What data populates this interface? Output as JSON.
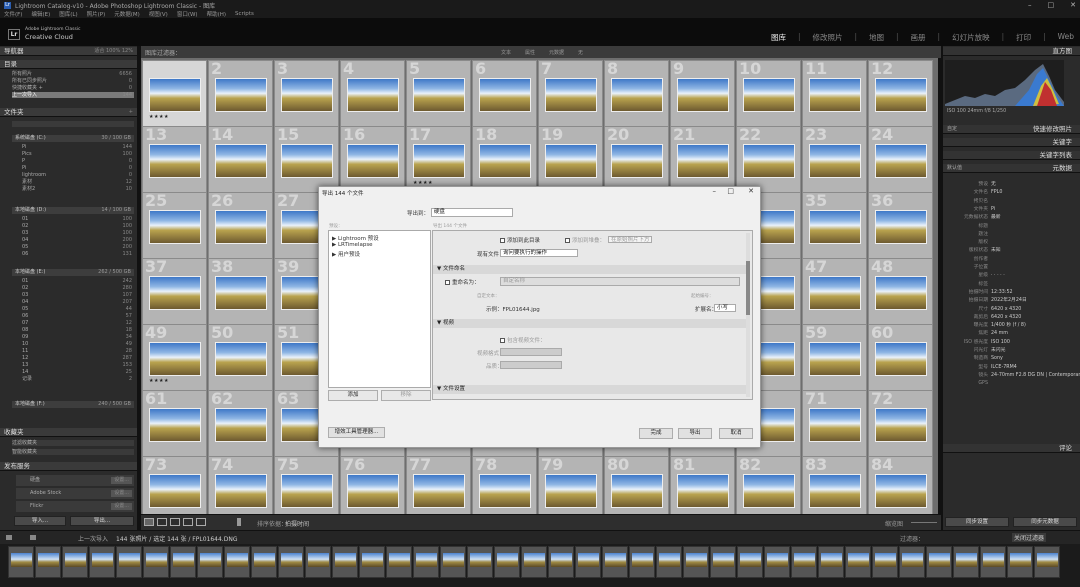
{
  "window": {
    "title": "Lightroom Catalog-v10 - Adobe Photoshop Lightroom Classic - 图库",
    "app_icon": "Lr"
  },
  "menu": [
    "文件(F)",
    "编辑(E)",
    "图库(L)",
    "照片(P)",
    "元数据(M)",
    "视图(V)",
    "窗口(W)",
    "帮助(H)",
    "Scripts"
  ],
  "brand": {
    "logo": "Lr",
    "line1": "Adobe Lightroom Classic",
    "line2": "Creative Cloud"
  },
  "modules": [
    "图库",
    "修改照片",
    "地图",
    "画册",
    "幻灯片放映",
    "打印",
    "Web"
  ],
  "left": {
    "navigator": {
      "title": "导航器",
      "opts": "适合  100%  12%"
    },
    "catalog": {
      "title": "目录",
      "items": [
        {
          "label": "所有照片",
          "count": "6656"
        },
        {
          "label": "所有已同步照片",
          "count": "0"
        },
        {
          "label": "快捷收藏夹 +",
          "count": "0"
        },
        {
          "label": "上一次导入",
          "count": "144"
        }
      ]
    },
    "folders": {
      "title": "文件夹",
      "filter": "+",
      "volumes": [
        {
          "label": "系统磁盘 (C:)",
          "count": "30 / 100 GB"
        },
        {
          "label": "本地磁盘 (D:)",
          "count": "14 / 100 GB"
        },
        {
          "label": "本地磁盘 (E:)",
          "count": "262 / 500 GB"
        }
      ],
      "c_items": [
        {
          "label": "Pi",
          "count": "144"
        },
        {
          "label": "Pics",
          "count": "100"
        },
        {
          "label": "P",
          "count": "0"
        },
        {
          "label": "Pi",
          "count": "0"
        },
        {
          "label": "lightroom",
          "count": "0"
        },
        {
          "label": "素材",
          "count": "12"
        },
        {
          "label": "素材2",
          "count": "10"
        }
      ],
      "d_items": [
        {
          "label": "01",
          "count": "100"
        },
        {
          "label": "02",
          "count": "100"
        },
        {
          "label": "03",
          "count": "100"
        },
        {
          "label": "04",
          "count": "200"
        },
        {
          "label": "05",
          "count": "200"
        },
        {
          "label": "06",
          "count": "131"
        }
      ],
      "e_items": [
        {
          "label": "01",
          "count": "242"
        },
        {
          "label": "02",
          "count": "280"
        },
        {
          "label": "03",
          "count": "107"
        },
        {
          "label": "04",
          "count": "207"
        },
        {
          "label": "05",
          "count": "44"
        },
        {
          "label": "06",
          "count": "57"
        },
        {
          "label": "07",
          "count": "12"
        },
        {
          "label": "08",
          "count": "18"
        },
        {
          "label": "09",
          "count": "34"
        },
        {
          "label": "10",
          "count": "49"
        },
        {
          "label": "11",
          "count": "28"
        },
        {
          "label": "12",
          "count": "287"
        },
        {
          "label": "13",
          "count": "153"
        },
        {
          "label": "14",
          "count": "25"
        },
        {
          "label": "记录",
          "count": "2"
        }
      ],
      "f_volume": {
        "label": "本地磁盘 (F:)",
        "count": "240 / 500 GB"
      }
    },
    "collections": {
      "title": "收藏夹",
      "items": [
        "过滤收藏夹",
        "智能收藏夹"
      ]
    },
    "publish": {
      "title": "发布服务",
      "items": [
        {
          "label": "硬盘",
          "action": "设置..."
        },
        {
          "label": "Adobe Stock",
          "action": "设置..."
        },
        {
          "label": "Flickr",
          "action": "设置..."
        }
      ]
    },
    "import_btn": "导入...",
    "export_btn": "导出..."
  },
  "filter": {
    "label": "图库过滤器：",
    "opts": [
      "文本",
      "属性",
      "元数据",
      "无"
    ]
  },
  "grid": {
    "start": 1,
    "rows": 7,
    "cols": 12,
    "stars": {
      "0": "★★★★",
      "16": "★★★★",
      "48": "★★★★"
    }
  },
  "right": {
    "histogram": "直方图",
    "hist_info": "ISO 100  24mm  f/8  1/250",
    "quick": "快速修改照片",
    "quick_left": "自定",
    "keyword": "关键字",
    "keyword_list": "关键字列表",
    "metadata": "元数据",
    "metadata_left": "默认值",
    "meta": [
      [
        "预设",
        "无"
      ],
      [
        "文件名",
        "FPL0"
      ],
      [
        "拷贝名",
        ""
      ],
      [
        "文件夹",
        "Pi"
      ],
      [
        "元数据状态",
        "最新"
      ],
      [
        "标题",
        ""
      ],
      [
        "题注",
        ""
      ],
      [
        "版权",
        ""
      ],
      [
        "版权状态",
        "未知"
      ],
      [
        "创作者",
        ""
      ],
      [
        "子位置",
        ""
      ],
      [
        "星级",
        "· · · · ·"
      ],
      [
        "标签",
        ""
      ],
      [
        "拍摄时间",
        "12:33:52"
      ],
      [
        "拍摄日期",
        "2022年2月24日"
      ],
      [
        "尺寸",
        "6420 x 4320"
      ],
      [
        "裁剪后",
        "6420 x 4320"
      ],
      [
        "曝光度",
        "1/400 秒 (f / 8)"
      ],
      [
        "焦距",
        "24 mm"
      ],
      [
        "ISO 感光度",
        "ISO 100"
      ],
      [
        "闪光灯",
        "未闪光"
      ],
      [
        "制造商",
        "Sony"
      ],
      [
        "型号",
        "ILCE-7RM4"
      ],
      [
        "镜头",
        "24-70mm F2.8 DG DN | Contemporary"
      ],
      [
        "GPS",
        ""
      ]
    ],
    "comments": "评论",
    "sync": "同步设置",
    "sync_meta": "同步元数据"
  },
  "toolbar": {
    "sort_label": "排序依据：",
    "sort": "拍摄时间",
    "thumb_label": "缩览图"
  },
  "filmhead": {
    "source": "上一次导入",
    "info": "144 张照片 / 选定 144 张 / FPL01644.DNG",
    "filter_label": "过滤器：",
    "filter_val": "关闭过滤器"
  },
  "dialog": {
    "title": "导出 144 个文件",
    "export_to_label": "导出到：",
    "export_to": "硬盘",
    "preset_label": "预设：",
    "preset_head": "导出 144 个文件",
    "presets": [
      "Lightroom 预设",
      "LRTimelapse",
      "用户预设"
    ],
    "add": "添加",
    "remove": "移除",
    "subfolder_label": "添加到此目录",
    "add_stack": "添加到堆叠：",
    "stack_pos": "在原始照片下方",
    "existing_label": "现有文件：",
    "existing": "询问要执行的操作",
    "sec_naming": "文件命名",
    "rename_label": "重命名为：",
    "rename_val": "自定名称",
    "custom_text": "自定文本：",
    "start_num": "起始编号：",
    "example_label": "示例：FPL01644.jpg",
    "ext_label": "扩展名：",
    "ext": "小写",
    "sec_video": "视频",
    "include_video": "包含视频文件：",
    "video_format": "视频格式：",
    "quality": "品质：",
    "sec_settings": "文件设置",
    "plugin_btn": "增效工具管理器...",
    "done": "完成",
    "export": "导出",
    "cancel": "取消"
  }
}
